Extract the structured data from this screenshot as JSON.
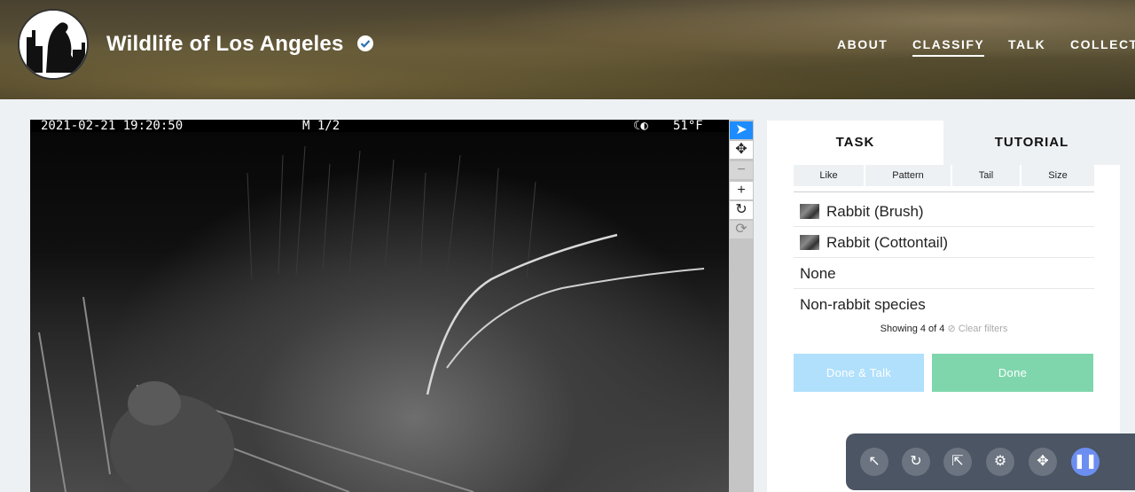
{
  "header": {
    "title": "Wildlife of Los Angeles",
    "verified_icon": "check-circle-icon",
    "nav": [
      {
        "label": "ABOUT",
        "active": false
      },
      {
        "label": "CLASSIFY",
        "active": true
      },
      {
        "label": "TALK",
        "active": false
      },
      {
        "label": "COLLECT",
        "active": false
      }
    ]
  },
  "image": {
    "timestamp": "2021-02-21 19:20:50",
    "mode": "M 1/2",
    "moon_icon": "moon-phase-icon",
    "temperature": "51°F"
  },
  "toolbar": {
    "tools": [
      {
        "icon": "pointer-icon",
        "glyph": "➤",
        "state": "active"
      },
      {
        "icon": "move-icon",
        "glyph": "✥",
        "state": "normal"
      },
      {
        "icon": "zoom-out-icon",
        "glyph": "−",
        "state": "disabled"
      },
      {
        "icon": "zoom-in-icon",
        "glyph": "+",
        "state": "normal"
      },
      {
        "icon": "rotate-icon",
        "glyph": "↻",
        "state": "normal"
      },
      {
        "icon": "reset-icon",
        "glyph": "⟳",
        "state": "disabled"
      }
    ]
  },
  "panel": {
    "tabs": [
      "TASK",
      "TUTORIAL"
    ],
    "filters": [
      "Like",
      "Pattern",
      "Tail",
      "Size"
    ],
    "choices": [
      {
        "label": "Rabbit (Brush)",
        "thumb": true
      },
      {
        "label": "Rabbit (Cottontail)",
        "thumb": true
      },
      {
        "label": "None",
        "thumb": false
      },
      {
        "label": "Non-rabbit species",
        "thumb": false
      }
    ],
    "showing": "Showing 4 of 4",
    "clear_filters": "Clear filters",
    "done_talk": "Done & Talk",
    "done": "Done"
  },
  "controls": {
    "icons": [
      "cursor-icon",
      "redo-cursor-icon",
      "multi-cursor-icon",
      "cursor-settings-icon",
      "move-arrows-icon",
      "pause-icon"
    ]
  },
  "colors": {
    "done_talk": "#b0e0fc",
    "done": "#7fd6ad",
    "active_tool": "#1c8cff",
    "control_bar": "#4b5563"
  }
}
